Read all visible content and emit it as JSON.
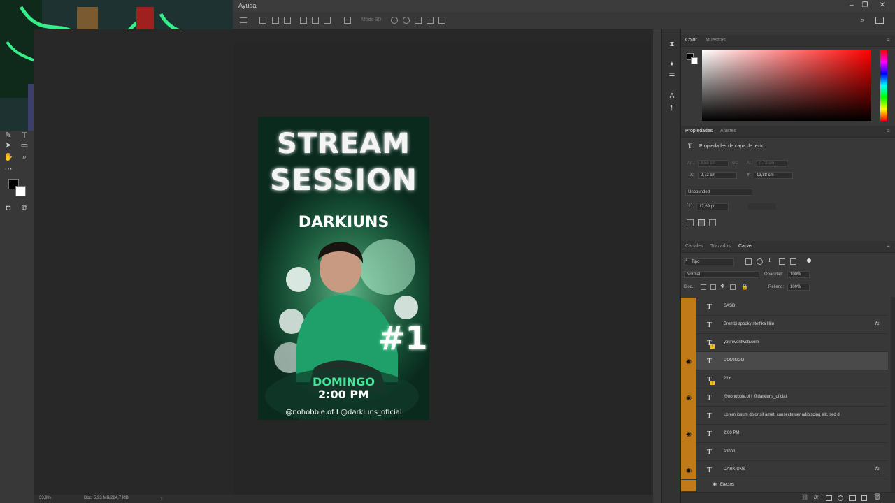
{
  "menu": {
    "help": "Ayuda"
  },
  "options": {
    "mode3d": "Modo 3D:"
  },
  "status": {
    "zoom": "33,9%",
    "doc": "Doc: 5,93 MB/224,7 MB",
    "arrow": "›"
  },
  "poster": {
    "title1": "STREAM",
    "title2": "SESSION",
    "name": "DARKIUNS",
    "number": "#1",
    "day": "DOMINGO",
    "time": "2:00 PM",
    "handles": "@nohobbie.of  I @darkiuns_oficial"
  },
  "color_panel": {
    "tab_color": "Color",
    "tab_swatches": "Muestras"
  },
  "properties": {
    "tab_props": "Propiedades",
    "tab_adjust": "Ajustes",
    "header": "Propiedades de capa de texto",
    "w_label": "An.:",
    "w_value": "3,59 cm",
    "link_label": "GO",
    "h_label": "Al.:",
    "h_value": "0,72 cm",
    "x_label": "X:",
    "x_value": "2,72 cm",
    "y_label": "Y:",
    "y_value": "13,88 cm",
    "bounding": "Unbounded",
    "font_size": "17,69 pt"
  },
  "layers_panel": {
    "tab_channels": "Canales",
    "tab_paths": "Trazados",
    "tab_layers": "Capas",
    "filter": "Tipo",
    "blend": "Normal",
    "opacity_label": "Opacidad:",
    "opacity_value": "100%",
    "lock_label": "Bloq.:",
    "fill_label": "Relleno:",
    "fill_value": "100%",
    "effects_label": "Efectos",
    "layers": [
      {
        "name": "SASD",
        "visible": false,
        "fx": false,
        "warn": false,
        "selected": false
      },
      {
        "name": "Brombi spooky steffika lililu",
        "visible": false,
        "fx": true,
        "warn": false,
        "selected": false
      },
      {
        "name": "youreventweb.com",
        "visible": false,
        "fx": false,
        "warn": true,
        "selected": false
      },
      {
        "name": "DOMINGO",
        "visible": true,
        "fx": false,
        "warn": false,
        "selected": true
      },
      {
        "name": "21+",
        "visible": false,
        "fx": false,
        "warn": true,
        "selected": false
      },
      {
        "name": "@nohobbie.of  I @darkiuns_oficial",
        "visible": true,
        "fx": false,
        "warn": false,
        "selected": false
      },
      {
        "name": "Lorem ipsum dolor sit amet, consectetuer adipiscing elit, sed d",
        "visible": false,
        "fx": false,
        "warn": false,
        "selected": false
      },
      {
        "name": "2:00 PM",
        "visible": true,
        "fx": false,
        "warn": false,
        "selected": false
      },
      {
        "name": "shhhh",
        "visible": false,
        "fx": false,
        "warn": false,
        "selected": false
      },
      {
        "name": "DARKIUNS",
        "visible": true,
        "fx": true,
        "warn": false,
        "selected": false
      }
    ]
  },
  "icons": {
    "eye": "eye-icon",
    "text_layer": "text-layer-icon",
    "fx": "fx-icon",
    "search": "search-icon"
  },
  "colors": {
    "accent_orange": "#c07a18",
    "poster_green": "#3bd488",
    "panel_bg": "#383838"
  }
}
